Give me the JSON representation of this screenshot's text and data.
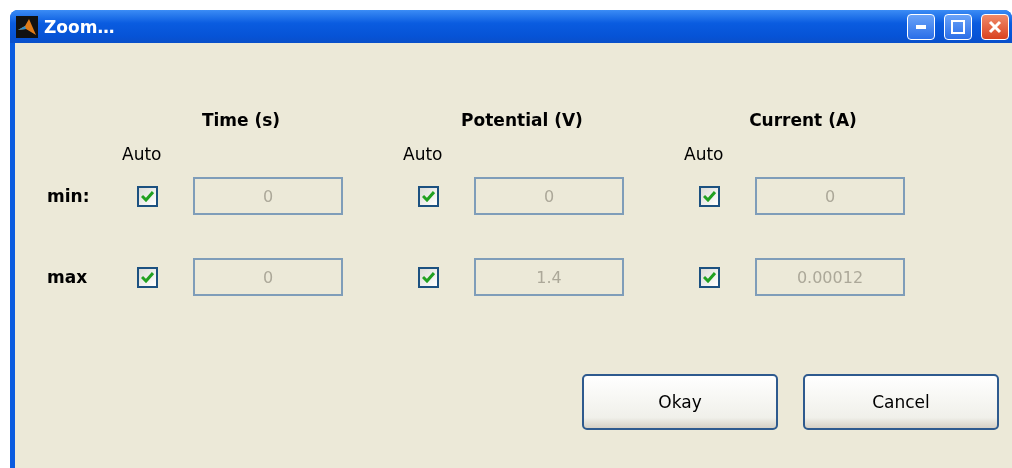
{
  "window": {
    "title": "Zoom…"
  },
  "row_labels": [
    "min:",
    "max"
  ],
  "groups": [
    {
      "heading": "Time (s)",
      "auto_label": "Auto",
      "min": {
        "checked": true,
        "value": "0"
      },
      "max": {
        "checked": true,
        "value": "0"
      }
    },
    {
      "heading": "Potential (V)",
      "auto_label": "Auto",
      "min": {
        "checked": true,
        "value": "0"
      },
      "max": {
        "checked": true,
        "value": "1.4"
      }
    },
    {
      "heading": "Current (A)",
      "auto_label": "Auto",
      "min": {
        "checked": true,
        "value": "0"
      },
      "max": {
        "checked": true,
        "value": "0.00012"
      }
    }
  ],
  "buttons": [
    "Okay",
    "Cancel"
  ]
}
